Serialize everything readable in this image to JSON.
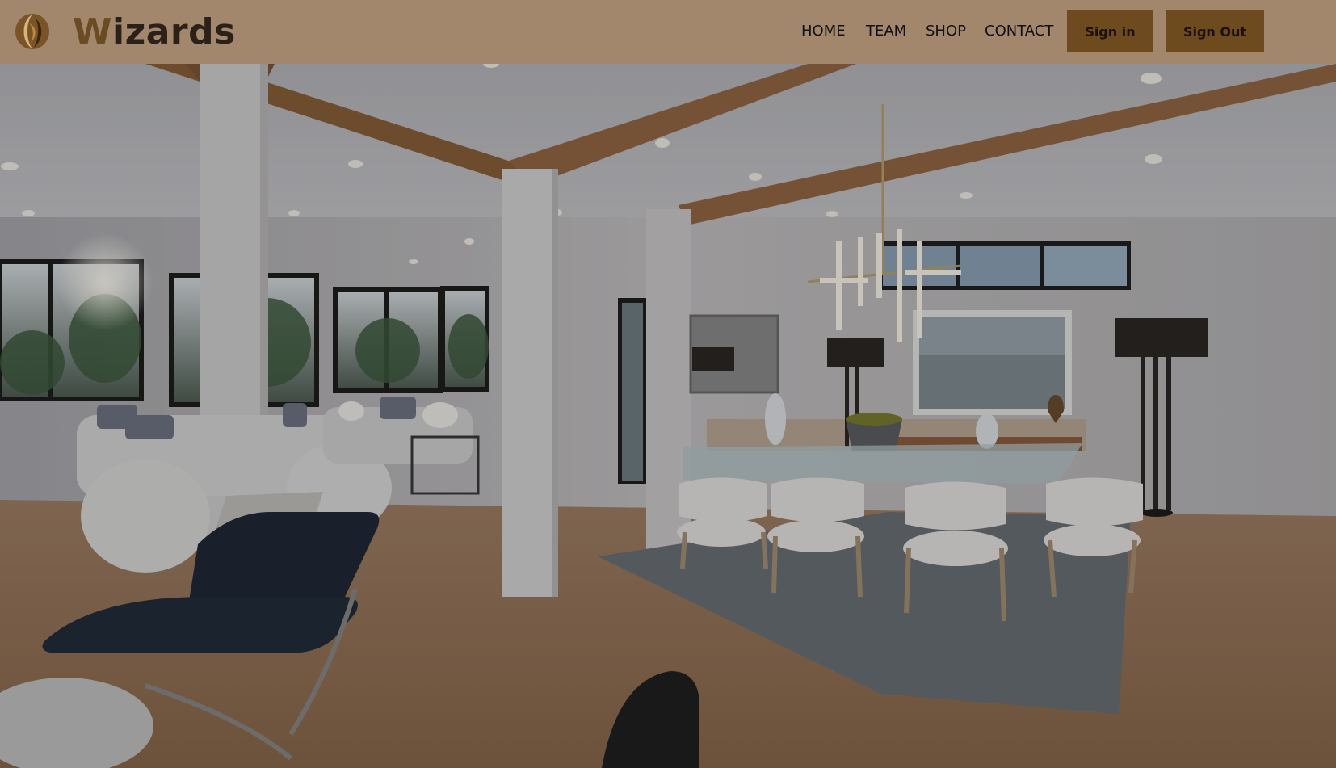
{
  "brand": {
    "first_letter": "W",
    "rest": "izards"
  },
  "nav": {
    "items": [
      {
        "label": "HOME"
      },
      {
        "label": "TEAM"
      },
      {
        "label": "SHOP"
      },
      {
        "label": "CONTACT"
      }
    ]
  },
  "auth": {
    "signin_label": "Sign in",
    "signout_label": "Sign Out"
  },
  "colors": {
    "header_bg": "#a3876d",
    "button_bg": "#6e4b1f",
    "brand_accent": "#6b4b22"
  },
  "hero": {
    "icon": "interior-photo"
  }
}
